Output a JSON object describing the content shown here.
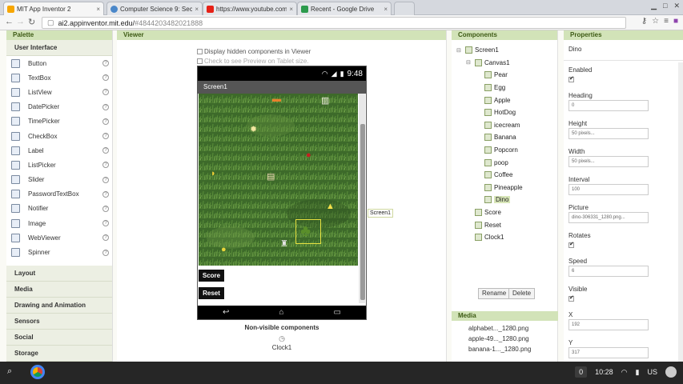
{
  "browser": {
    "tabs": [
      {
        "label": "MIT App Inventor 2",
        "color": "#f7a600"
      },
      {
        "label": "Computer Science 9: Secti",
        "color": "#4a87c9"
      },
      {
        "label": "https://www.youtube.com",
        "color": "#e62117"
      },
      {
        "label": "Recent - Google Drive",
        "color": "#2d9b4d"
      }
    ],
    "url_host": "ai2.appinventor.mit.edu/",
    "url_hash": "#4844203482021888"
  },
  "palette": {
    "header": "Palette",
    "section_open": "User Interface",
    "items": [
      "Button",
      "TextBox",
      "ListView",
      "DatePicker",
      "TimePicker",
      "CheckBox",
      "Label",
      "ListPicker",
      "Slider",
      "PasswordTextBox",
      "Notifier",
      "Image",
      "WebViewer",
      "Spinner"
    ],
    "help": "?",
    "sections": [
      "Layout",
      "Media",
      "Drawing and Animation",
      "Sensors",
      "Social",
      "Storage"
    ]
  },
  "viewer": {
    "header": "Viewer",
    "opt_hidden": "Display hidden components in Viewer",
    "opt_tablet": "Check to see Preview on Tablet size.",
    "status_time": "9:48",
    "screen_title": "Screen1",
    "canvas_tag": "Screen1",
    "btn_score": "Score",
    "btn_reset": "Reset",
    "nonvisible_title": "Non-visible components",
    "nonvisible_item": "Clock1"
  },
  "components": {
    "header": "Components",
    "tree": [
      {
        "label": "Screen1",
        "level": 0,
        "toggle": "⊟"
      },
      {
        "label": "Canvas1",
        "level": 1,
        "toggle": "⊟"
      },
      {
        "label": "Pear",
        "level": 2
      },
      {
        "label": "Egg",
        "level": 2
      },
      {
        "label": "Apple",
        "level": 2
      },
      {
        "label": "HotDog",
        "level": 2
      },
      {
        "label": "icecream",
        "level": 2
      },
      {
        "label": "Banana",
        "level": 2
      },
      {
        "label": "Popcorn",
        "level": 2
      },
      {
        "label": "poop",
        "level": 2
      },
      {
        "label": "Coffee",
        "level": 2
      },
      {
        "label": "Pineapple",
        "level": 2
      },
      {
        "label": "Dino",
        "level": 2,
        "selected": true
      },
      {
        "label": "Score",
        "level": 1
      },
      {
        "label": "Reset",
        "level": 1
      },
      {
        "label": "Clock1",
        "level": 1
      }
    ],
    "rename": "Rename",
    "delete": "Delete"
  },
  "media": {
    "header": "Media",
    "files": [
      "alphabet..._1280.png",
      "apple-49..._1280.png",
      "banana-1..._1280.png"
    ]
  },
  "properties": {
    "header": "Properties",
    "component": "Dino",
    "enabled_label": "Enabled",
    "heading_label": "Heading",
    "heading": "0",
    "height_label": "Height",
    "height": "50 pixels...",
    "width_label": "Width",
    "width": "50 pixels...",
    "interval_label": "Interval",
    "interval": "100",
    "picture_label": "Picture",
    "picture": "dino-306331_1280.png...",
    "rotates_label": "Rotates",
    "speed_label": "Speed",
    "speed": "6",
    "visible_label": "Visible",
    "x_label": "X",
    "x": "192",
    "y_label": "Y",
    "y": "317",
    "z_label": "Z"
  },
  "taskbar": {
    "notif_count": "0",
    "time": "10:28",
    "locale": "US"
  }
}
